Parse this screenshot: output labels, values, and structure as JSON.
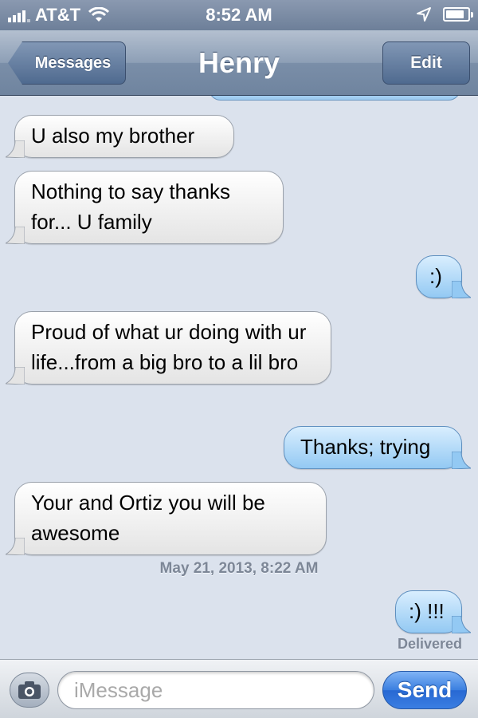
{
  "status_bar": {
    "carrier": "AT&T",
    "time": "8:52 AM",
    "icons": [
      "signal-icon",
      "wifi-icon",
      "location-icon",
      "battery-icon"
    ],
    "battery_level": 0.85
  },
  "nav": {
    "back_label": "Messages",
    "title": "Henry",
    "edit_label": "Edit"
  },
  "messages": [
    {
      "direction": "in",
      "text": "U also my brother"
    },
    {
      "direction": "in",
      "text": "Nothing to say thanks for... U family"
    },
    {
      "direction": "out",
      "text": ":)"
    },
    {
      "direction": "in",
      "text": "Proud of what ur doing with ur life...from a big bro to a lil bro"
    },
    {
      "direction": "out",
      "text": "Thanks; trying"
    },
    {
      "direction": "in",
      "text": "Your and Ortiz you will be awesome"
    },
    {
      "direction": "out",
      "text": ":) !!!"
    }
  ],
  "timestamp": "May 21, 2013, 8:22 AM",
  "delivered_label": "Delivered",
  "input": {
    "placeholder": "iMessage",
    "value": "",
    "send_label": "Send"
  },
  "colors": {
    "background": "#dbe2ed",
    "nav_bar": "#7a8ea8",
    "incoming_bubble": "#e4e4e4",
    "outgoing_bubble": "#93c9f3",
    "send_button": "#2768d3"
  }
}
